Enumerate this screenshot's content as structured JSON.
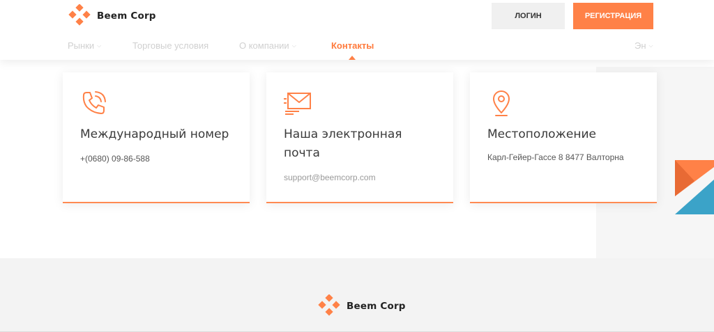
{
  "brand": {
    "name": "Beem Corp",
    "accent_color": "#ff8147",
    "secondary_color": "#3ba3c8"
  },
  "header": {
    "login_label": "логин",
    "register_label": "регистрация"
  },
  "nav": {
    "items": [
      {
        "label": "Рынки",
        "has_dropdown": true
      },
      {
        "label": "Торговые условия",
        "has_dropdown": false
      },
      {
        "label": "О компании",
        "has_dropdown": true
      },
      {
        "label": "Контакты",
        "has_dropdown": false,
        "active": true
      },
      {
        "label": "Эн",
        "has_dropdown": true
      }
    ]
  },
  "cards": [
    {
      "icon": "phone-icon",
      "title": "Международный номер",
      "value": "+(0680) 09-86-588"
    },
    {
      "icon": "mail-icon",
      "title": "Наша электронная почта",
      "value": "support@beemcorp.com"
    },
    {
      "icon": "location-pin-icon",
      "title": "Местоположение",
      "value": "Карл-Гейер-Гассе 8 8477 Валторна"
    }
  ],
  "footer": {
    "brand_name": "Beem Corp"
  }
}
